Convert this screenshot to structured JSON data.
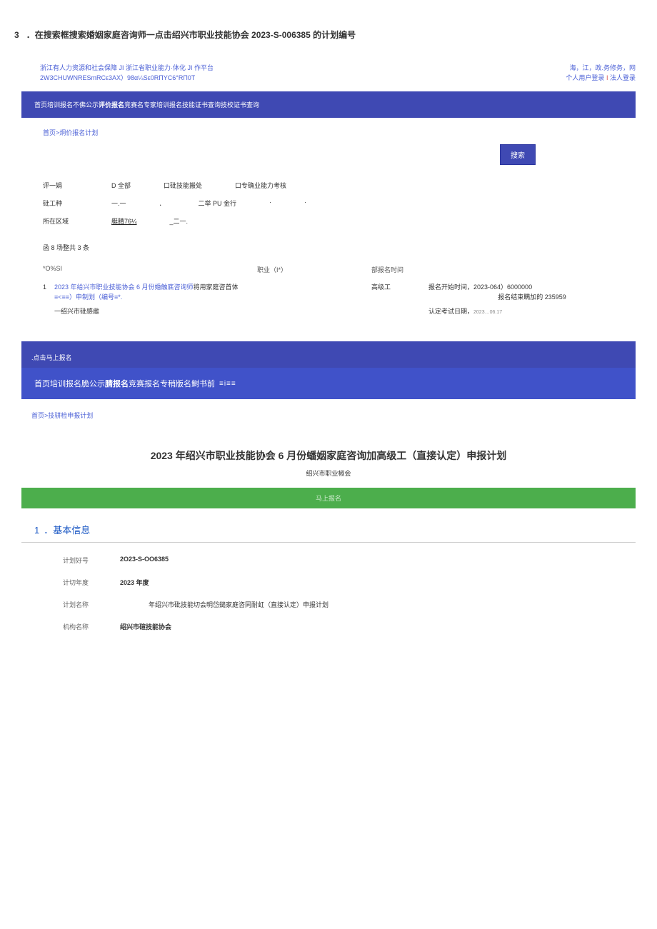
{
  "step": {
    "num": "3",
    "text": "．在搜索框搜索婚姻家庭咨询师一点击绍兴市职业技能协会 2023-S-006385 的计划编号"
  },
  "header": {
    "line1": "浙江有人力资源和社会保障 JI 浙江省职业能力·体化 JI 作平台",
    "line2": "2W3CHUWNRESmRCε3AX）98α¼Sε0RПYC6°RП0T",
    "rightLine1": "海，江，政.务修务，网",
    "rightLine2a": "个人用户登录",
    "rightLine2b": "I",
    "rightLine2c": "法人登录"
  },
  "navbar1": {
    "pre": "首页培训报名不佛公示",
    "bold": "评价报名",
    "post": "竞赛名专家培训报名技能证书查询技校证书查询"
  },
  "breadcrumb1": "首页>炯价报名计划",
  "searchBtn": "搜索",
  "filters": {
    "row1": {
      "label": "评一娟",
      "opt1": "D 全部",
      "opt2": "口砒技能搬处",
      "opt3": "口专确业能力考核"
    },
    "row2": {
      "label": "砒工种",
      "opt1": "一.一",
      "opt2": "．",
      "opt3": "二举 PU 金行",
      "opt4": "·",
      "opt5": "·"
    },
    "row3": {
      "label": "所在区域",
      "opt1": "艇腈76¼",
      "opt2": "_二一."
    }
  },
  "count": "函 8 场整共 3 条",
  "tableHead": {
    "colA": "*O%SI",
    "colB": "职业（I*）",
    "colC": "部报名时间"
  },
  "result": {
    "idx": "1",
    "titleBlue": "2023 年给兴市职业技能协会 6 月份婚触底咨询师",
    "titleBlack": "将用家庭咨首体",
    "sub": "≡<≡≡）申制划（编号≡*.",
    "gap": "",
    "level": "高级工",
    "timeLine1": "报名开始时间，2023-064）6000000",
    "timeLine2": "报名结束瞒加的 235959"
  },
  "subRow": {
    "org": "一绍兴市砒感雌",
    "examLabel": "认定考试日期，",
    "examDate": "2023…06.17"
  },
  "clickNote": ".点击马上报名",
  "navbar2": {
    "pre": "首页培训报名脆公示",
    "bold": "腈报名",
    "post": "竞赛报名专稍版名鲥书前",
    "icon": "≡i≡≡"
  },
  "breadcrumb2": "首页>技骈检申报计划",
  "planTitle": "2023 年绍兴市职业技能协会 6 月份蟠姻家庭咨询加高级工（直接认定）申报计划",
  "planSub": "绍兴市职业椒会",
  "greenBtn": "马上报名",
  "section1": {
    "num": "1",
    "title": "．基本信息"
  },
  "info": {
    "row1": {
      "label": "计划好号",
      "value": "2O23-S-OO6385"
    },
    "row2": {
      "label": "计切年度",
      "value": "2023 年度"
    },
    "row3": {
      "label": "计划名称",
      "value": "年绍兴市砒技能切会明岱鎚家庭咨同耐虹（直接认定）申报计划"
    },
    "row4": {
      "label": "机构名称",
      "value": "绍兴市碹技能协会"
    }
  }
}
